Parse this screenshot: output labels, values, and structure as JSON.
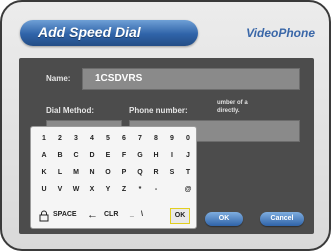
{
  "header": {
    "title": "Add Speed Dial",
    "brand": "VideoPhone"
  },
  "form": {
    "name_label": "Name:",
    "name_value": "1CSDVRS",
    "dial_method_label": "Dial Method:",
    "phone_number_label": "Phone number:",
    "hint_line1": "umber of a",
    "hint_line2": "directly."
  },
  "keyboard": {
    "rows": [
      [
        "1",
        "2",
        "3",
        "4",
        "5",
        "6",
        "7",
        "8",
        "9",
        "0"
      ],
      [
        "A",
        "B",
        "C",
        "D",
        "E",
        "F",
        "G",
        "H",
        "I",
        "J"
      ],
      [
        "K",
        "L",
        "M",
        "N",
        "O",
        "P",
        "Q",
        "R",
        "S",
        "T"
      ],
      [
        "U",
        "V",
        "W",
        "X",
        "Y",
        "Z",
        "*",
        "-",
        "",
        "@"
      ]
    ],
    "space_label": "SPACE",
    "clear_label": "CLR",
    "ok_label": "OK"
  },
  "buttons": {
    "ok_label": "OK",
    "cancel_label": "Cancel"
  },
  "colors": {
    "accent_blue": "#2f63a8",
    "panel": "#4c4c4c",
    "field": "#8a8a8a",
    "ok_highlight": "#e2cf20"
  }
}
